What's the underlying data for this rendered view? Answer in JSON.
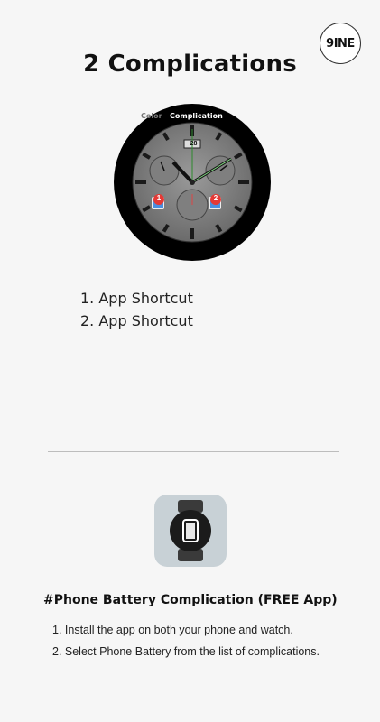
{
  "brand": {
    "logo_text": "9INE"
  },
  "header": {
    "title": "2 Complications"
  },
  "watch_preview": {
    "tabs": [
      "Color",
      "Complication"
    ],
    "date_label": "28",
    "slot_labels": [
      "1",
      "2"
    ],
    "accent_colors": {
      "slot_badge": "#e53935",
      "hand_lume": "#7ed07e"
    }
  },
  "complications": {
    "items": [
      "1. App Shortcut",
      "2. App Shortcut"
    ]
  },
  "promo": {
    "icon": "watch-phone-icon",
    "heading": "#Phone Battery Complication (FREE App)",
    "steps": [
      "1. Install the app on both your phone and watch.",
      "2. Select Phone Battery from the list of complications."
    ]
  }
}
